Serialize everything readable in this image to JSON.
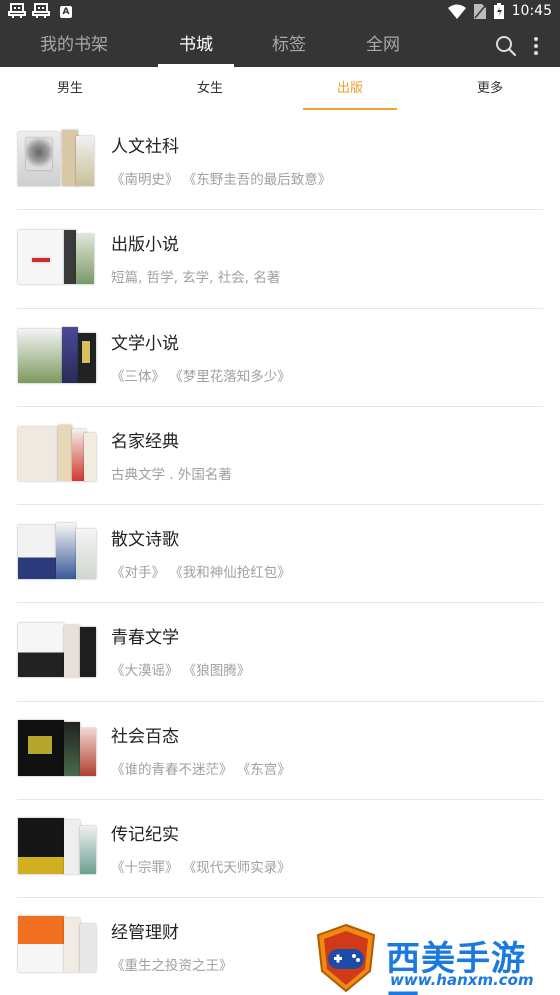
{
  "status_bar": {
    "left_icons": [
      "ghost-icon",
      "ghost-icon",
      "a-badge-icon"
    ],
    "time": "10:45",
    "right_icons": [
      "wifi-icon",
      "sim-icon",
      "battery-icon"
    ]
  },
  "header": {
    "tabs": [
      {
        "label": "我的书架",
        "active": false
      },
      {
        "label": "书城",
        "active": true
      },
      {
        "label": "标签",
        "active": false
      },
      {
        "label": "全网",
        "active": false
      }
    ],
    "actions": [
      "search-icon",
      "more-vertical-icon"
    ]
  },
  "sub_tabs": [
    {
      "label": "男生",
      "active": false
    },
    {
      "label": "女生",
      "active": false
    },
    {
      "label": "出版",
      "active": true
    },
    {
      "label": "更多",
      "active": false
    }
  ],
  "categories": [
    {
      "title": "人文社科",
      "subtitle": "《南明史》 《东野圭吾的最后致意》"
    },
    {
      "title": "出版小说",
      "subtitle": "短篇, 哲学, 玄学, 社会, 名著"
    },
    {
      "title": "文学小说",
      "subtitle": "《三体》 《梦里花落知多少》"
    },
    {
      "title": "名家经典",
      "subtitle": "古典文学 . 外国名著"
    },
    {
      "title": "散文诗歌",
      "subtitle": "《对手》 《我和神仙抢红包》"
    },
    {
      "title": "青春文学",
      "subtitle": "《大漠谣》 《狼图腾》"
    },
    {
      "title": "社会百态",
      "subtitle": "《谁的青春不迷茫》 《东宫》"
    },
    {
      "title": "传记纪实",
      "subtitle": "《十宗罪》 《现代天师实录》"
    },
    {
      "title": "经管理财",
      "subtitle": "《重生之投资之王》"
    }
  ],
  "watermark": {
    "name": "西美手游网",
    "url": "www.hanxm.com"
  },
  "colors": {
    "header_bg": "#353535",
    "accent": "#f0a030",
    "watermark_blue": "#1a7ae0"
  }
}
